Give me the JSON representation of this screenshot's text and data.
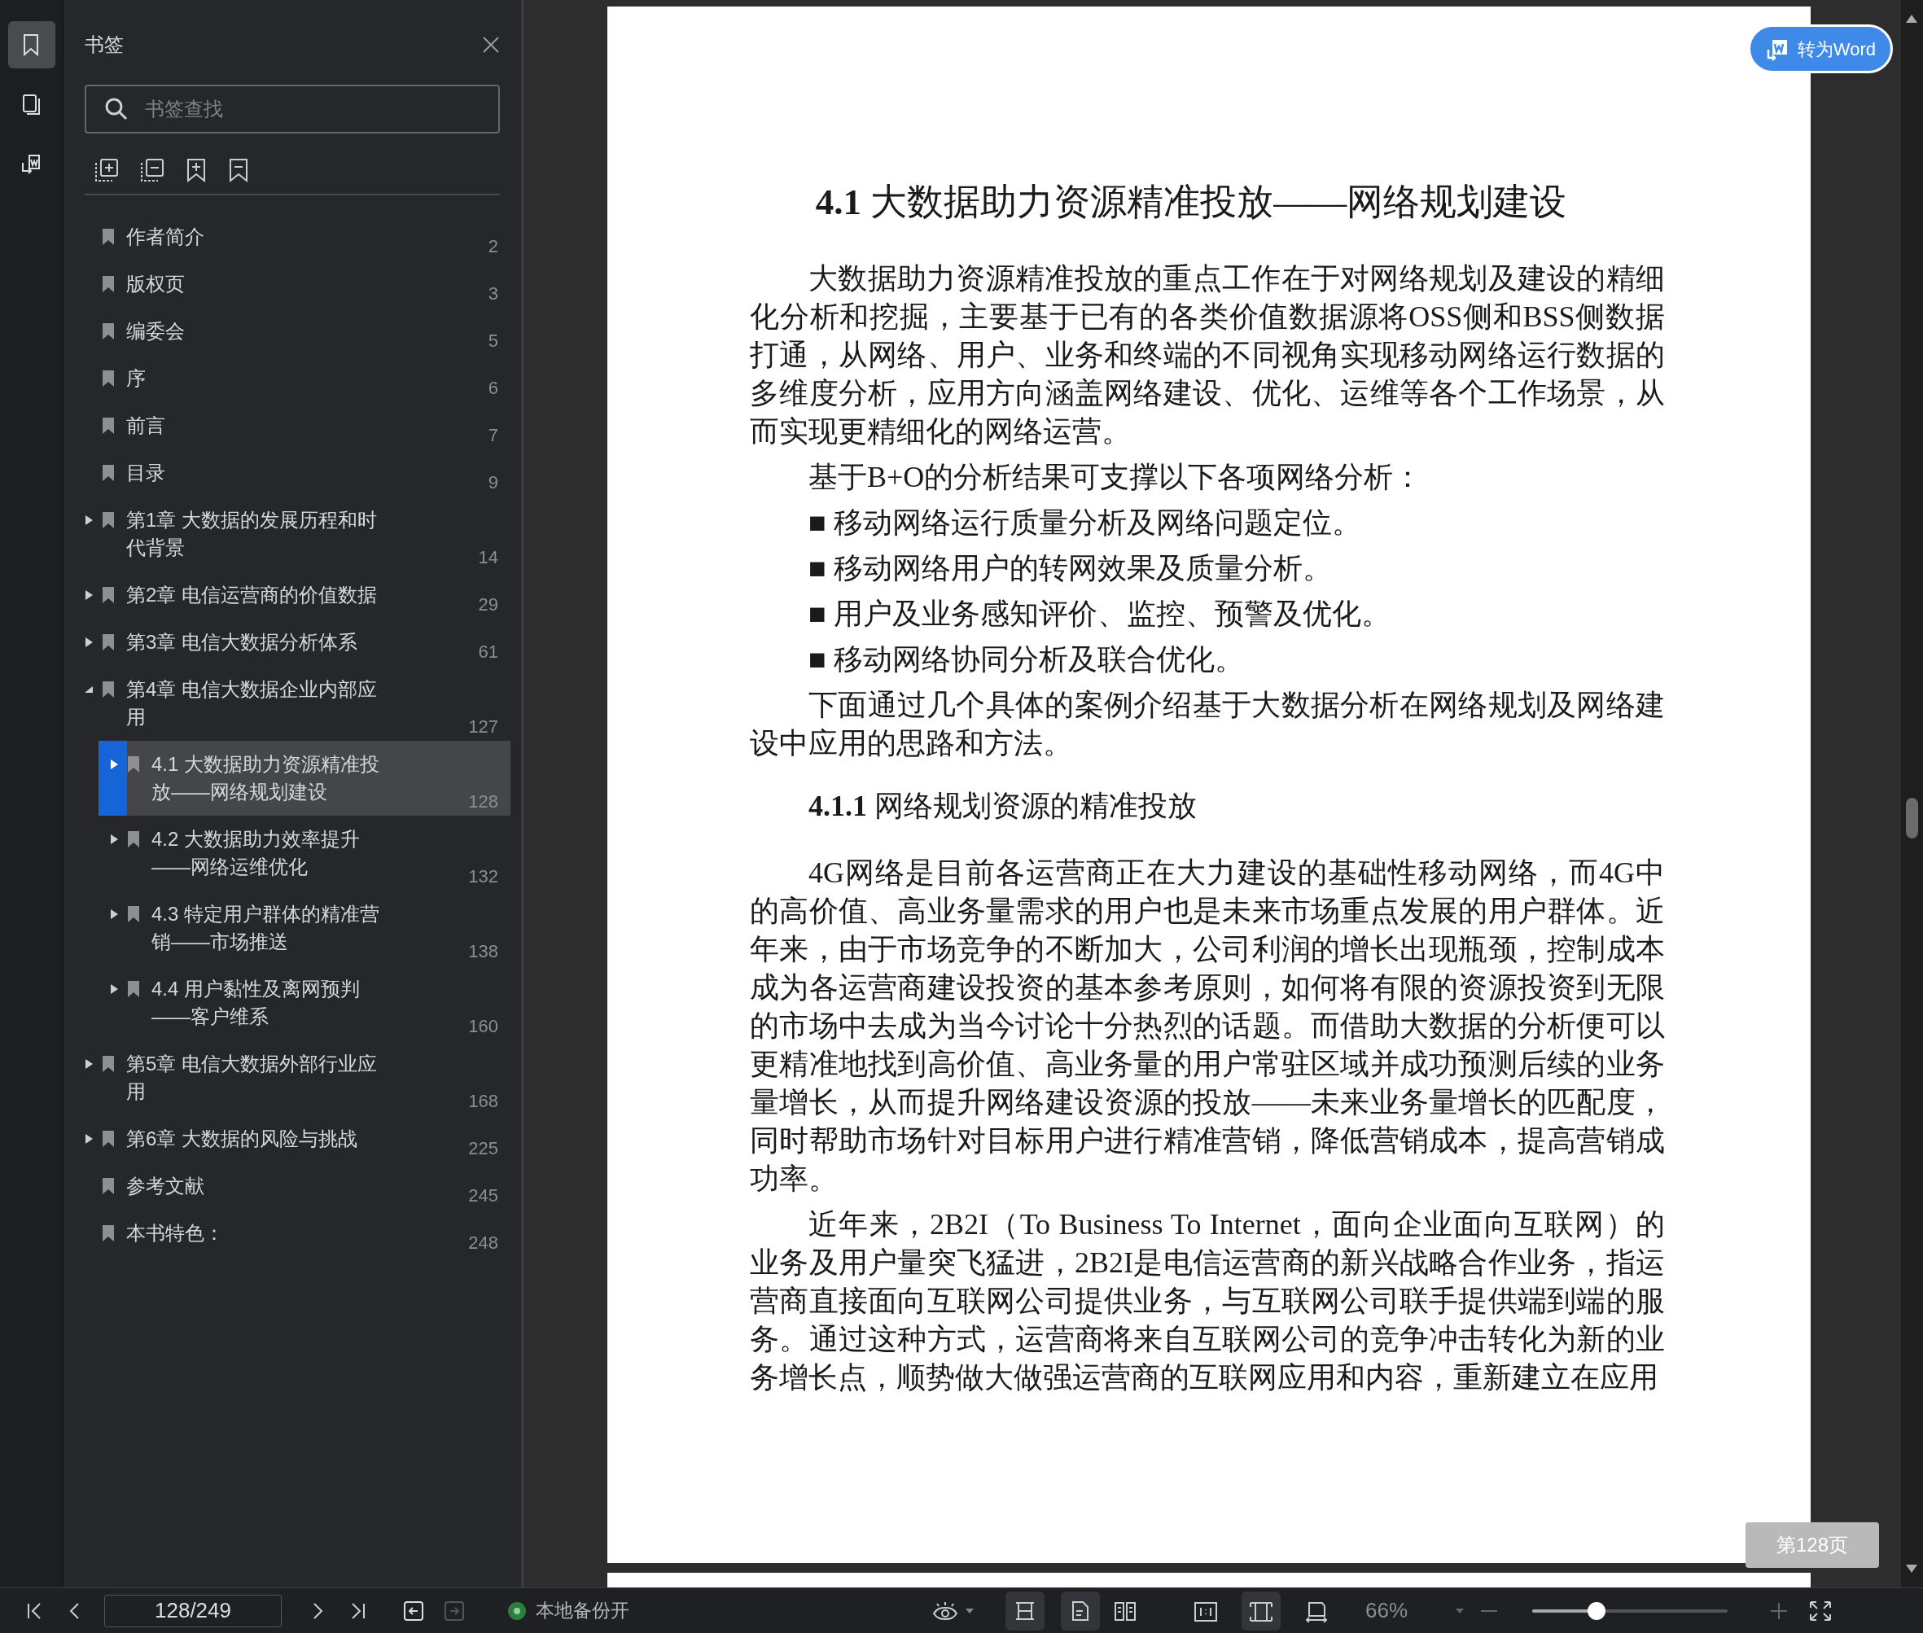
{
  "rail": [
    {
      "selected": true
    },
    {
      "selected": false
    },
    {
      "selected": false
    }
  ],
  "sidebar": {
    "title": "书签",
    "search": {
      "placeholder": "书签查找"
    },
    "bookmarks": [
      {
        "label": "作者简介",
        "page": "2",
        "expandable": false,
        "selected": false
      },
      {
        "label": "版权页",
        "page": "3",
        "expandable": false,
        "selected": false
      },
      {
        "label": "编委会",
        "page": "5",
        "expandable": false,
        "selected": false
      },
      {
        "label": "序",
        "page": "6",
        "expandable": false,
        "selected": false
      },
      {
        "label": "前言",
        "page": "7",
        "expandable": false,
        "selected": false
      },
      {
        "label": "目录",
        "page": "9",
        "expandable": false,
        "selected": false
      },
      {
        "label": "第1章 大数据的发展历程和时代背景",
        "page": "14",
        "expandable": true,
        "expanded": false,
        "selected": false
      },
      {
        "label": "第2章 电信运营商的价值数据",
        "page": "29",
        "expandable": true,
        "expanded": false,
        "selected": false
      },
      {
        "label": "第3章 电信大数据分析体系",
        "page": "61",
        "expandable": true,
        "expanded": false,
        "selected": false
      },
      {
        "label": "第4章 电信大数据企业内部应用",
        "page": "127",
        "expandable": true,
        "expanded": true,
        "selected": false,
        "children": [
          {
            "label": "4.1 大数据助力资源精准投放——网络规划建设",
            "page": "128",
            "expandable": true,
            "expanded": false,
            "selected": true
          },
          {
            "label": "4.2 大数据助力效率提升——网络运维优化",
            "page": "132",
            "expandable": true,
            "expanded": false,
            "selected": false
          },
          {
            "label": "4.3 特定用户群体的精准营销——市场推送",
            "page": "138",
            "expandable": true,
            "expanded": false,
            "selected": false
          },
          {
            "label": "4.4 用户黏性及离网预判——客户维系",
            "page": "160",
            "expandable": true,
            "expanded": false,
            "selected": false
          }
        ]
      },
      {
        "label": "第5章 电信大数据外部行业应用",
        "page": "168",
        "expandable": true,
        "expanded": false,
        "selected": false
      },
      {
        "label": "第6章 大数据的风险与挑战",
        "page": "225",
        "expandable": true,
        "expanded": false,
        "selected": false
      },
      {
        "label": "参考文献",
        "page": "245",
        "expandable": false,
        "selected": false
      },
      {
        "label": "本书特色：",
        "page": "248",
        "expandable": false,
        "selected": false
      }
    ]
  },
  "document": {
    "blocks": [
      {
        "kind": "heading",
        "text": "**4.1** 大数据助力资源精准投放——网络规划建设"
      },
      {
        "kind": "para",
        "text": "大数据助力资源精准投放的重点工作在于对网络规划及建设的精细化分析和挖掘，主要基于已有的各类价值数据源将OSS侧和BSS侧数据打通，从网络、用户、业务和终端的不同视角实现移动网络运行数据的多维度分析，应用方向涵盖网络建设、优化、运维等各个工作场景，从而实现更精细化的网络运营。"
      },
      {
        "kind": "para",
        "text": "基于B+O的分析结果可支撑以下各项网络分析："
      },
      {
        "kind": "bullet",
        "text": "■ 移动网络运行质量分析及网络问题定位。"
      },
      {
        "kind": "bullet",
        "text": "■ 移动网络用户的转网效果及质量分析。"
      },
      {
        "kind": "bullet",
        "text": "■ 用户及业务感知评价、监控、预警及优化。"
      },
      {
        "kind": "bullet",
        "text": "■ 移动网络协同分析及联合优化。"
      },
      {
        "kind": "para",
        "text": "下面通过几个具体的案例介绍基于大数据分析在网络规划及网络建设中应用的思路和方法。"
      },
      {
        "kind": "subheading",
        "text": "**4.1.1** 网络规划资源的精准投放"
      },
      {
        "kind": "para",
        "text": "4G网络是目前各运营商正在大力建设的基础性移动网络，而4G中的高价值、高业务量需求的用户也是未来市场重点发展的用户群体。近年来，由于市场竞争的不断加大，公司利润的增长出现瓶颈，控制成本成为各运营商建设投资的基本参考原则，如何将有限的资源投资到无限的市场中去成为当今讨论十分热烈的话题。而借助大数据的分析便可以更精准地找到高价值、高业务量的用户常驻区域并成功预测后续的业务量增长，从而提升网络建设资源的投放——未来业务量增长的匹配度，同时帮助市场针对目标用户进行精准营销，降低营销成本，提高营销成功率。"
      },
      {
        "kind": "para",
        "text": "近年来，2B2I（To Business To Internet，面向企业面向互联网）的业务及用户量突飞猛进，2B2I是电信运营商的新兴战略合作业务，指运营商直接面向互联网公司提供业务，与互联网公司联手提供端到端的服务。通过这种方式，运营商将来自互联网公司的竞争冲击转化为新的业务增长点，顺势做大做强运营商的互联网应用和内容，重新建立在应用"
      }
    ]
  },
  "convert_button": "转为Word",
  "page_badge": "第128页",
  "bottom_bar": {
    "page_field": "128/249",
    "history": [
      {
        "disabled": false
      },
      {
        "disabled": true
      }
    ],
    "backup": {
      "label": "本地备份开",
      "on": true
    },
    "view_tools": [
      {
        "selected": true
      },
      {
        "selected": true
      },
      {
        "selected": false
      },
      {
        "selected": false
      },
      {
        "selected": true
      },
      {
        "selected": false
      }
    ],
    "zoom": {
      "value": "66%",
      "level": 0.33
    }
  }
}
